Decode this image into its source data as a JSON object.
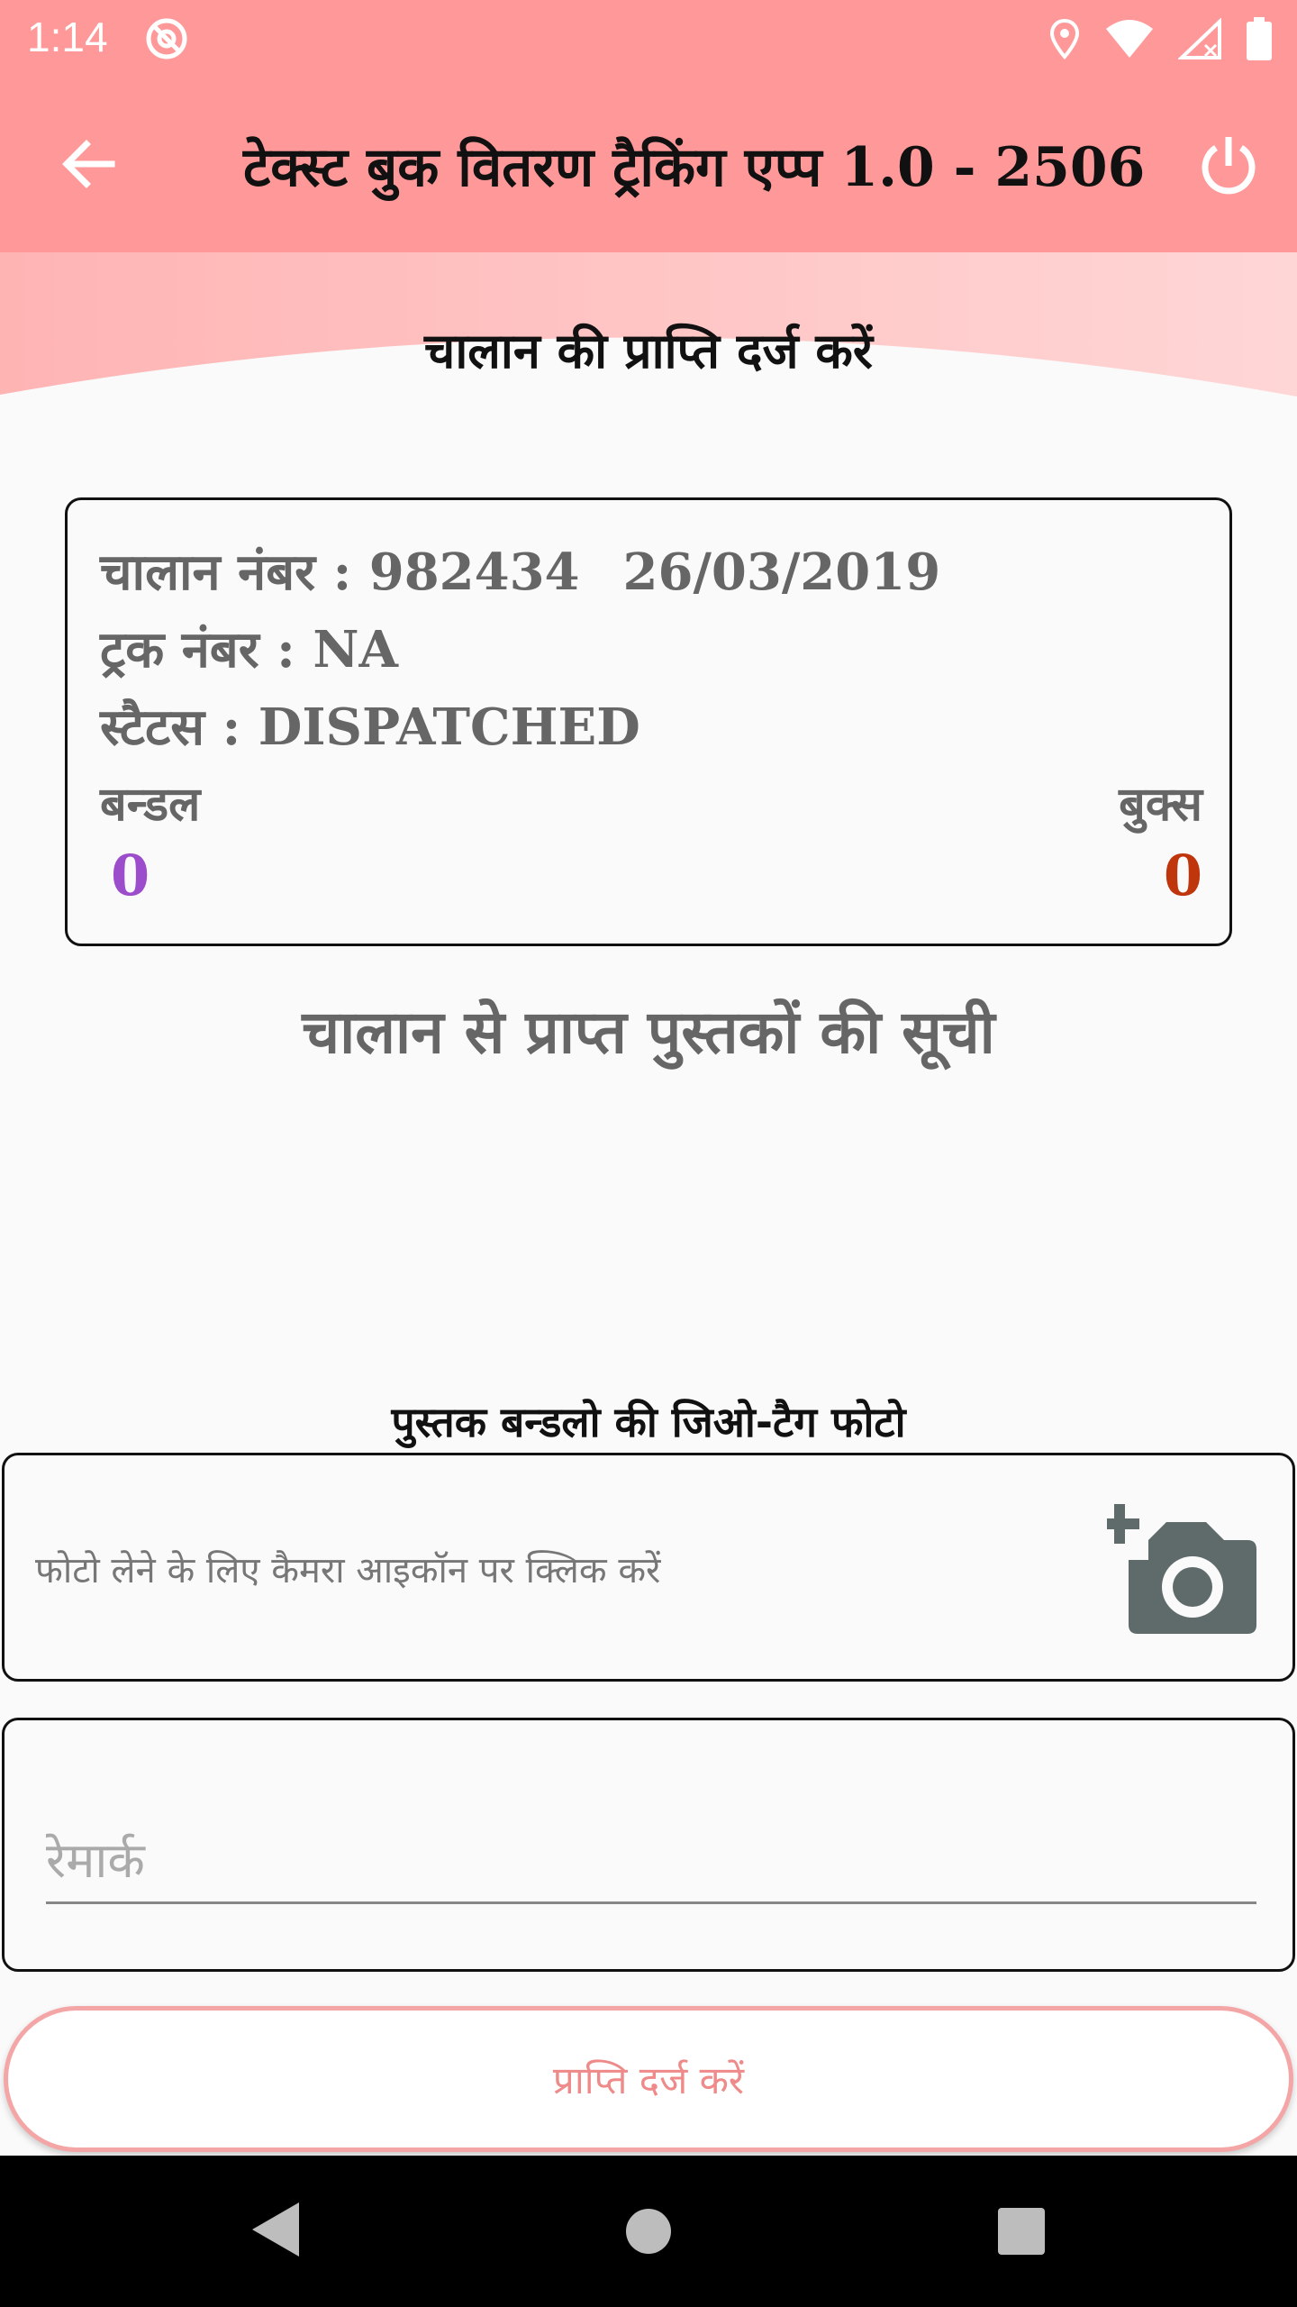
{
  "status_bar": {
    "time": "1:14",
    "icons": [
      "do-not-disturb-icon",
      "location-icon",
      "wifi-icon",
      "signal-icon",
      "battery-icon"
    ]
  },
  "app_bar": {
    "title": "टेक्स्ट बुक वितरण ट्रैकिंग एप्प 1.0 - 2506",
    "back_icon": "arrow-back-icon",
    "power_icon": "power-icon",
    "color": "#ff9999"
  },
  "header_band": {
    "title": "चालान की प्राप्ति दर्ज करें"
  },
  "challan_card": {
    "challan_label": "चालान नंबर : 982434",
    "date": "26/03/2019",
    "truck_label": "ट्रक नंबर : NA",
    "status_label": "स्टैटस : DISPATCHED",
    "bundle_label": "बन्डल",
    "bundle_value": "0",
    "books_label": "बुक्स",
    "books_value": "0",
    "bundle_color": "#9c4dcc",
    "books_color": "#bf360c"
  },
  "list_title": "चालान से प्राप्त पुस्तकों की सूची",
  "photo_section": {
    "heading": "पुस्तक बन्डलो की जिओ-टैग फोटो",
    "hint": "फोटो लेने के लिए कैमरा आइकॉन पर क्लिक करें",
    "camera_icon": "add-camera-icon"
  },
  "remark": {
    "placeholder": "रेमार्क",
    "value": ""
  },
  "submit_button": {
    "label": "प्राप्ति दर्ज करें"
  },
  "nav_bar": {
    "icons": [
      "nav-back-icon",
      "nav-home-icon",
      "nav-recents-icon"
    ]
  }
}
